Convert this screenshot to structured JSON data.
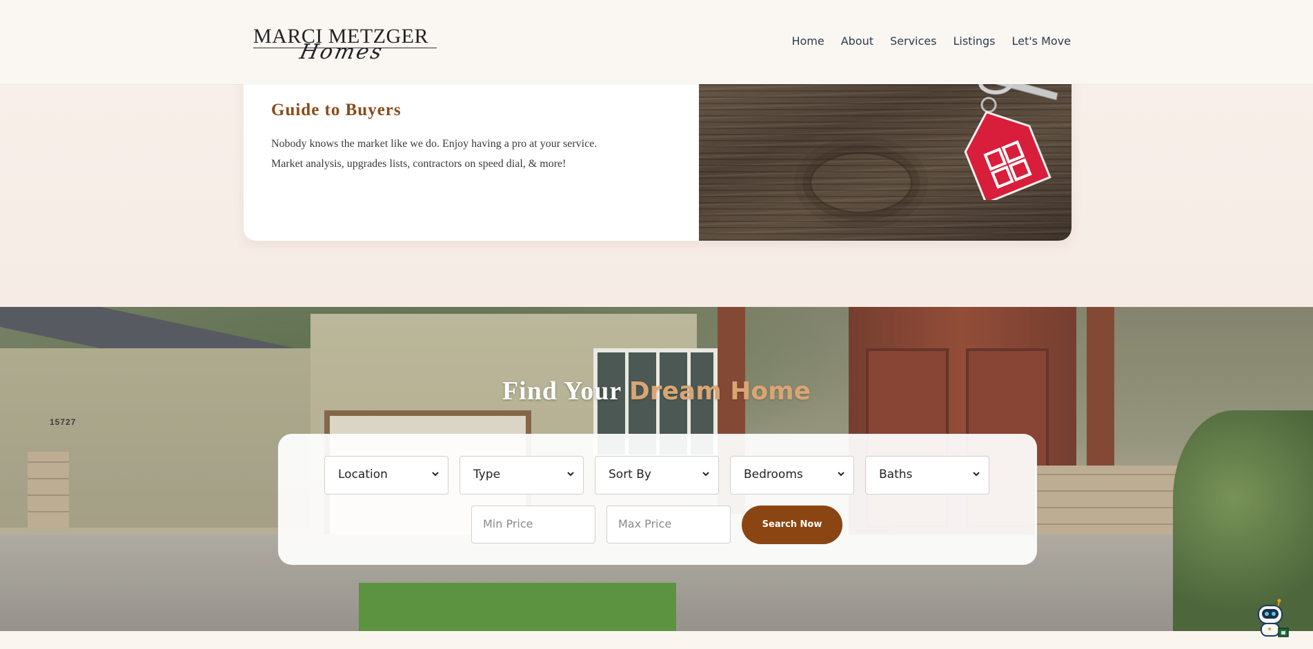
{
  "header": {
    "logo": {
      "main": "MARCI METZGER",
      "script": "Homes"
    },
    "nav": [
      {
        "label": "Home"
      },
      {
        "label": "About"
      },
      {
        "label": "Services"
      },
      {
        "label": "Listings"
      },
      {
        "label": "Let's Move"
      }
    ]
  },
  "guide": {
    "title": "Guide to Buyers",
    "body_line1": "Nobody knows the market like we do. Enjoy having a pro at your service.",
    "body_line2": "Market analysis, upgrades lists, contractors on speed dial, & more!"
  },
  "hero": {
    "title_part1": "Find Your",
    "title_part2": "Dream Home",
    "house_number": "15727",
    "filters": [
      {
        "label": "Location"
      },
      {
        "label": "Type"
      },
      {
        "label": "Sort By"
      },
      {
        "label": "Bedrooms"
      },
      {
        "label": "Baths"
      }
    ],
    "min_price_placeholder": "Min Price",
    "max_price_placeholder": "Max Price",
    "search_button": "Search Now"
  },
  "colors": {
    "brand_brown": "#8b4513",
    "accent_tan": "#d9a574",
    "guide_title": "#8b4a17"
  },
  "icons": {
    "dropdown": "chevron-down-icon",
    "chat": "robot-chat-icon",
    "keys": "house-keychain-icon"
  }
}
